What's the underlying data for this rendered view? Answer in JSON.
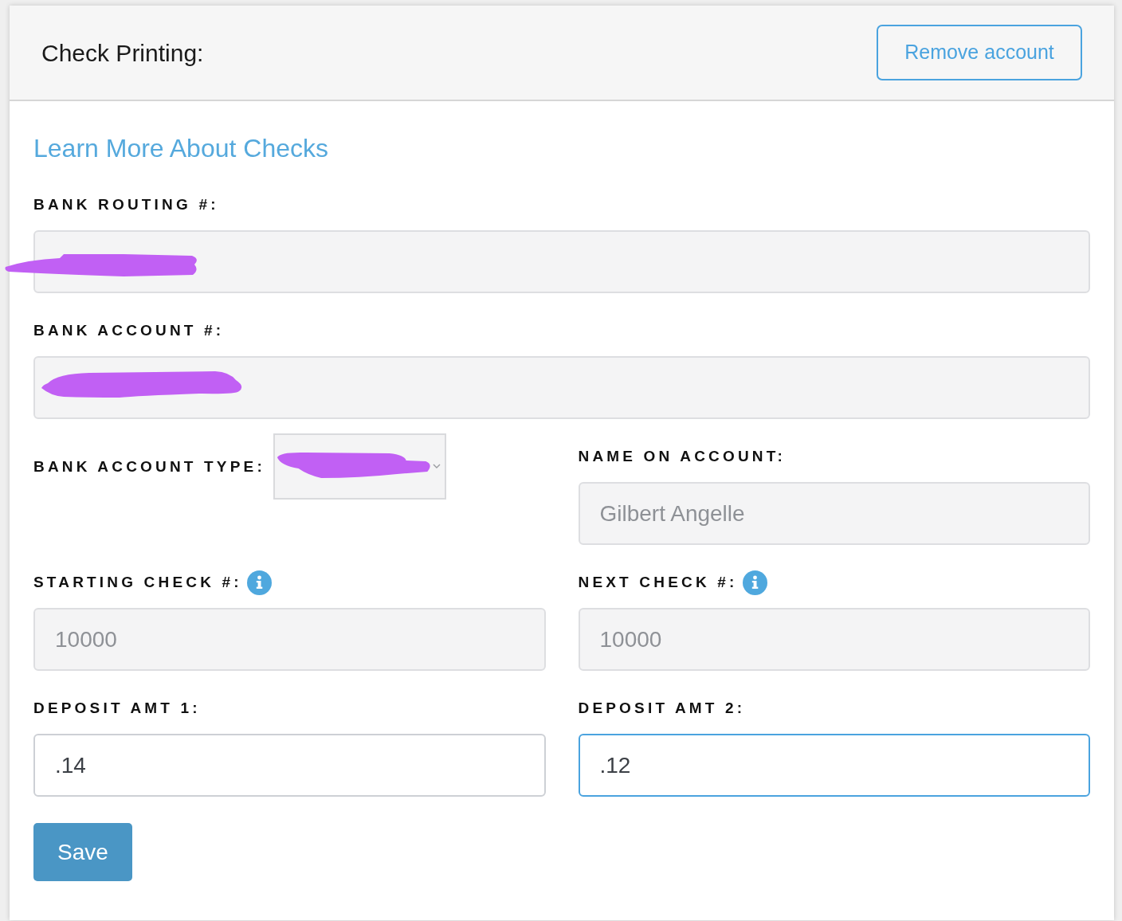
{
  "header": {
    "title": "Check Printing:",
    "button": "Remove account"
  },
  "link": "Learn More About Checks",
  "rows": [
    [
      {
        "kind": "input",
        "label": "BANK ROUTING #:",
        "disabled": true,
        "redacted": true
      }
    ],
    [
      {
        "kind": "input",
        "label": "BANK ACCOUNT #:",
        "disabled": true,
        "redacted": true
      }
    ],
    [
      {
        "kind": "select",
        "label": "BANK ACCOUNT TYPE:",
        "disabled": true,
        "redacted": true
      },
      {
        "kind": "input",
        "label": "NAME ON ACCOUNT:",
        "disabled": true,
        "value": "Gilbert Angelle"
      }
    ],
    [
      {
        "kind": "input",
        "label": "STARTING CHECK #:",
        "info": true,
        "disabled": true,
        "value": "10000"
      },
      {
        "kind": "input",
        "label": "NEXT CHECK #:",
        "info": true,
        "disabled": true,
        "value": "10000"
      }
    ],
    [
      {
        "kind": "input",
        "label": "DEPOSIT AMT 1:",
        "disabled": false,
        "focused": false,
        "value": ".14"
      },
      {
        "kind": "input",
        "label": "DEPOSIT AMT 2:",
        "disabled": false,
        "focused": true,
        "value": ".12"
      }
    ]
  ],
  "save_button": "Save"
}
